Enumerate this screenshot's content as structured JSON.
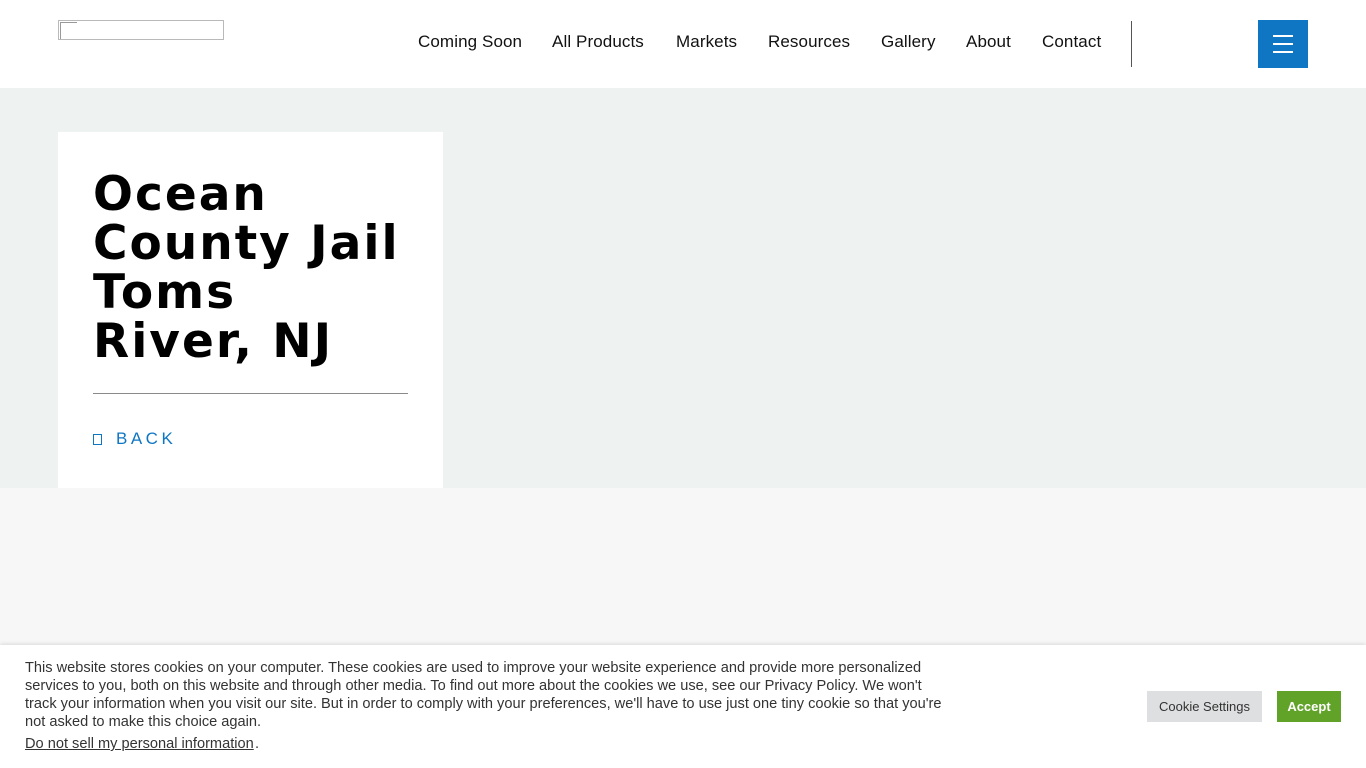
{
  "header": {
    "logo_alt": "",
    "nav": [
      {
        "label": "Coming Soon"
      },
      {
        "label": "All Products"
      },
      {
        "label": "Markets"
      },
      {
        "label": "Resources"
      },
      {
        "label": "Gallery"
      },
      {
        "label": "About"
      },
      {
        "label": "Contact"
      }
    ],
    "menu_icon": "hamburger-icon"
  },
  "hero": {
    "title": "Ocean County Jail Toms River, NJ",
    "back_label": "BACK",
    "back_icon": "arrow-left-icon"
  },
  "cookie_banner": {
    "text": "This website stores cookies on your computer. These cookies are used to improve your website experience and provide more personalized services to you, both on this website and through other media. To find out more about the cookies we use, see our Privacy Policy. We won't track your information when you visit our site. But in order to comply with your preferences, we'll have to use just one tiny cookie so that you're not asked to make this choice again.",
    "do_not_sell_label": "Do not sell my personal information",
    "do_not_sell_suffix": ".",
    "settings_label": "Cookie Settings",
    "accept_label": "Accept"
  },
  "colors": {
    "accent": "#0f76c4",
    "hero_bg": "#eef2f1",
    "accept_bg": "#61a229"
  }
}
